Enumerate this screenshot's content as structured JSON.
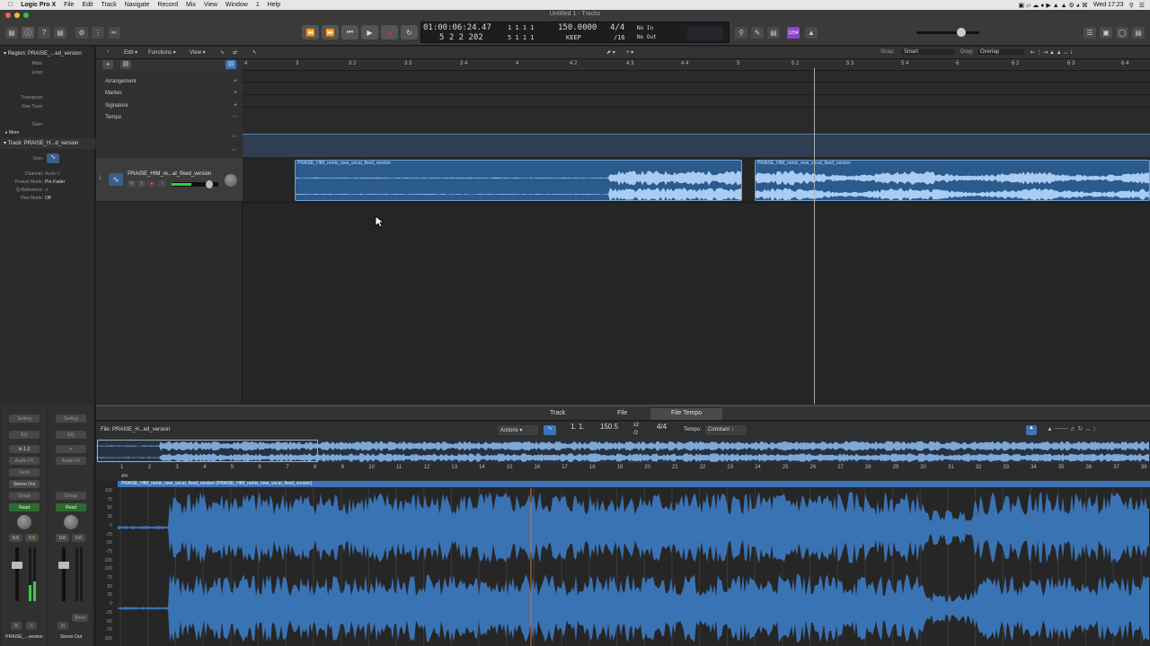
{
  "menubar": {
    "app": "Logic Pro X",
    "items": [
      "File",
      "Edit",
      "Track",
      "Navigate",
      "Record",
      "Mix",
      "View",
      "Window",
      "1",
      "Help"
    ],
    "clock": "Wed 17:23"
  },
  "window_title": "Untitled 1 - Tracks",
  "lcd": {
    "time": "01:00:06:24.47",
    "bars": "5  2  2  202",
    "pos_top": "1  1  1     1",
    "pos_bot": "5  1  1     1",
    "tempo": "150.0000",
    "keep": "KEEP",
    "sig_top": "4/4",
    "sig_bot": "/16",
    "in": "No In",
    "out": "No Out"
  },
  "colors": {
    "accent": "#4a8fd8",
    "region": "#2b5a8c",
    "wave": "#a9cdf2",
    "record": "#d8302c"
  },
  "inspector": {
    "region_header": "Region: PRAISE_...ed_version",
    "rows": [
      "Mute:",
      "Loop:",
      "Transpose:",
      "Fine Tune:",
      "Gain:"
    ],
    "more": "More",
    "track_header": "Track: PRAISE_H...d_version",
    "icon_label": "Icon:",
    "track_rows": [
      {
        "k": "Channel:",
        "v": "Audio 1"
      },
      {
        "k": "Freeze Mode:",
        "v": "Pre Fader"
      },
      {
        "k": "Q-Reference:",
        "v": "✓"
      },
      {
        "k": "Flex Mode:",
        "v": "Off"
      }
    ],
    "strip_left": {
      "setting": "Setting",
      "eq": "EQ",
      "input": "In 1-2",
      "fx": "Audio FX",
      "send": "Send",
      "output": "Stereo Out",
      "group": "Group",
      "read": "Read",
      "val1": "0.0",
      "val2": "0.0",
      "m": "M",
      "s": "S",
      "name": "PRAISE_...version"
    },
    "strip_right": {
      "setting": "Setting",
      "eq": "EQ",
      "fx": "Audio FX",
      "group": "Group",
      "read": "Read",
      "val1": "0.0",
      "val2": "0.0",
      "m": "M",
      "bnce": "Bnce",
      "name": "Stereo Out"
    }
  },
  "tracks_toolbar": {
    "edit": "Edit",
    "functions": "Functions",
    "view": "View",
    "snap_label": "Snap:",
    "snap": "Smart",
    "drag_label": "Drag:",
    "drag": "Overlap"
  },
  "ruler": [
    "4",
    "3",
    "3 2",
    "3 3",
    "3 4",
    "4",
    "4 2",
    "4 3",
    "4 4",
    "5",
    "5 2",
    "5 3",
    "5 4",
    "6",
    "6 2",
    "6 3",
    "6 4"
  ],
  "global_tracks": [
    "Arrangement",
    "Marker",
    "Signature",
    "Tempo"
  ],
  "tempo_scale": [
    "170",
    "130",
    "110"
  ],
  "track": {
    "number": "1",
    "name": "PRAISE_HIM_re...al_fixed_version",
    "m": "M",
    "s": "S",
    "i": "I"
  },
  "regions": [
    {
      "name": "PRAISE_HIM_remix_new_vocal_fixed_version"
    },
    {
      "name": "PRAISE_HIM_remix_new_vocal_fixed_version"
    }
  ],
  "editor": {
    "tabs": [
      "Track",
      "File",
      "File Tempo"
    ],
    "file_label": "File: PRAISE_H...ed_version",
    "actions": "Actions",
    "pos": "1. 1.",
    "tempo": "150.5",
    "x2": "x2",
    "div2": "/2",
    "sig": "4/4",
    "tempo_label": "Tempo:",
    "tempo_mode": "Constant",
    "ruler": [
      "1",
      "2",
      "3",
      "4",
      "5",
      "6",
      "7",
      "8",
      "9",
      "10",
      "11",
      "12",
      "13",
      "14",
      "15",
      "16",
      "17",
      "18",
      "19",
      "20",
      "21",
      "22",
      "23",
      "24",
      "25",
      "26",
      "27",
      "28",
      "29",
      "30",
      "31",
      "32",
      "33",
      "34",
      "35",
      "36",
      "37",
      "38"
    ],
    "sig_mark": "4/4",
    "region_title": "PRAISE_HIM_remix_new_vocal_fixed_version (PRAISE_HIM_remix_new_vocal_fixed_version)",
    "y_scale": [
      "100",
      "75",
      "50",
      "25",
      "0",
      "-25",
      "-50",
      "-75",
      "-100",
      "100",
      "75",
      "50",
      "25",
      "0",
      "-25",
      "-50",
      "-75",
      "-100"
    ]
  }
}
